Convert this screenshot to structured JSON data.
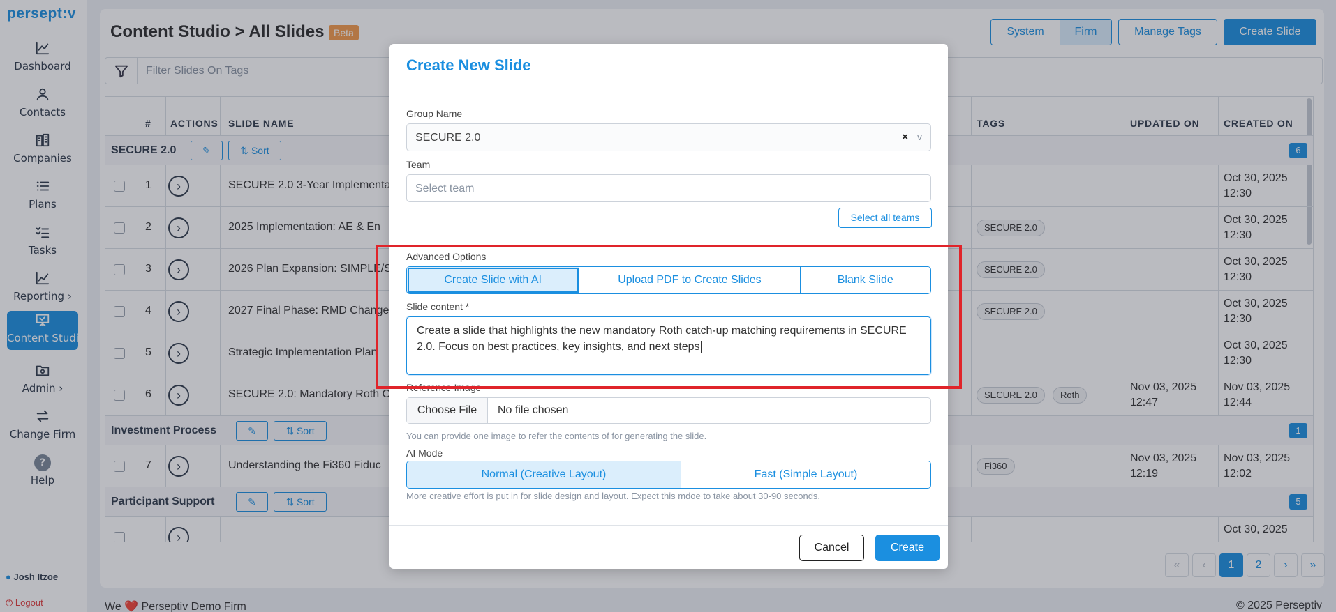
{
  "brand": {
    "logo": "persept:v"
  },
  "sidebar": {
    "items": [
      {
        "label": "Dashboard",
        "icon": "chart-line-icon"
      },
      {
        "label": "Contacts",
        "icon": "user-icon"
      },
      {
        "label": "Companies",
        "icon": "building-icon"
      },
      {
        "label": "Plans",
        "icon": "list-icon"
      },
      {
        "label": "Tasks",
        "icon": "checklist-icon"
      },
      {
        "label": "Reporting",
        "icon": "chart-icon",
        "suffix": "›"
      },
      {
        "label": "Content Studio",
        "icon": "presentation-icon"
      },
      {
        "label": "Admin",
        "icon": "folder-gear-icon",
        "suffix": "›"
      },
      {
        "label": "Change Firm",
        "icon": "swap-icon"
      },
      {
        "label": "Help",
        "icon": "question-icon"
      }
    ],
    "user": "Josh Itzoe",
    "logout": "Logout"
  },
  "header": {
    "title": "Content Studio > All Slides",
    "badge": "Beta",
    "toggle": [
      "System",
      "Firm"
    ],
    "manage_tags": "Manage Tags",
    "create_slide": "Create Slide"
  },
  "filter": {
    "placeholder": "Filter Slides On Tags"
  },
  "table": {
    "columns": [
      "#",
      "ACTIONS",
      "SLIDE NAME",
      "TAGS",
      "UPDATED ON",
      "CREATED ON"
    ],
    "edit_icon": "edit-icon",
    "sort_label": "Sort",
    "groups": [
      {
        "name": "SECURE 2.0",
        "count": "6"
      },
      {
        "name": "Investment Process",
        "count": "1"
      },
      {
        "name": "Participant Support",
        "count": "5"
      }
    ],
    "rows": [
      {
        "n": "1",
        "name": "SECURE 2.0 3-Year Implementa",
        "tags": [],
        "updated": "",
        "created1": "Oct 30, 2025",
        "created2": "12:30"
      },
      {
        "n": "2",
        "name": "2025 Implementation: AE & En",
        "tags": [
          "SECURE 2.0"
        ],
        "updated": "",
        "created1": "Oct 30, 2025",
        "created2": "12:30"
      },
      {
        "n": "3",
        "name": "2026 Plan Expansion: SIMPLE/S",
        "tags": [
          "SECURE 2.0"
        ],
        "updated": "",
        "created1": "Oct 30, 2025",
        "created2": "12:30"
      },
      {
        "n": "4",
        "name": "2027 Final Phase: RMD Change",
        "tags": [
          "SECURE 2.0"
        ],
        "updated": "",
        "created1": "Oct 30, 2025",
        "created2": "12:30"
      },
      {
        "n": "5",
        "name": "Strategic Implementation Plan",
        "tags": [],
        "updated": "",
        "created1": "Oct 30, 2025",
        "created2": "12:30"
      },
      {
        "n": "6",
        "name": "SECURE 2.0: Mandatory Roth C",
        "tags": [
          "SECURE 2.0",
          "Roth"
        ],
        "updated1": "Nov 03, 2025",
        "updated2": "12:47",
        "created1": "Nov 03, 2025",
        "created2": "12:44"
      },
      {
        "n": "7",
        "name": "Understanding the Fi360 Fiduc",
        "tags": [
          "Fi360"
        ],
        "updated1": "Nov 03, 2025",
        "updated2": "12:19",
        "created1": "Nov 03, 2025",
        "created2": "12:02"
      }
    ],
    "partial_created": "Oct 30, 2025"
  },
  "pagination": {
    "first": "«",
    "prev": "‹",
    "pages": [
      "1",
      "2"
    ],
    "next": "›",
    "last": "»"
  },
  "footer": {
    "left": "We ❤️ Perseptiv Demo Firm",
    "right": "© 2025 Perseptiv"
  },
  "modal": {
    "title": "Create New Slide",
    "group_label": "Group Name",
    "group_value": "SECURE 2.0",
    "clear": "×",
    "chevron": "v",
    "team_label": "Team",
    "team_placeholder": "Select team",
    "select_all": "Select all teams",
    "adv_label": "Advanced Options",
    "adv_options": [
      "Create Slide with AI",
      "Upload PDF to Create Slides",
      "Blank Slide"
    ],
    "content_label": "Slide content *",
    "content_value": "Create a slide that highlights the new mandatory Roth catch-up matching requirements in SECURE 2.0.  Focus on best practices, key insights, and next steps",
    "ref_label": "Reference Image",
    "choose_file": "Choose File",
    "no_file": "No file chosen",
    "ref_hint": "You can provide one image to refer the contents of for generating the slide.",
    "ai_mode_label": "AI Mode",
    "ai_modes": [
      "Normal (Creative Layout)",
      "Fast (Simple Layout)"
    ],
    "ai_hint": "More creative effort is put in for slide design and layout. Expect this mdoe to take about 30-90 seconds.",
    "cancel": "Cancel",
    "create": "Create"
  },
  "colors": {
    "accent": "#1b8fe0",
    "highlight": "#e0242a",
    "beta": "#f39a4a"
  }
}
